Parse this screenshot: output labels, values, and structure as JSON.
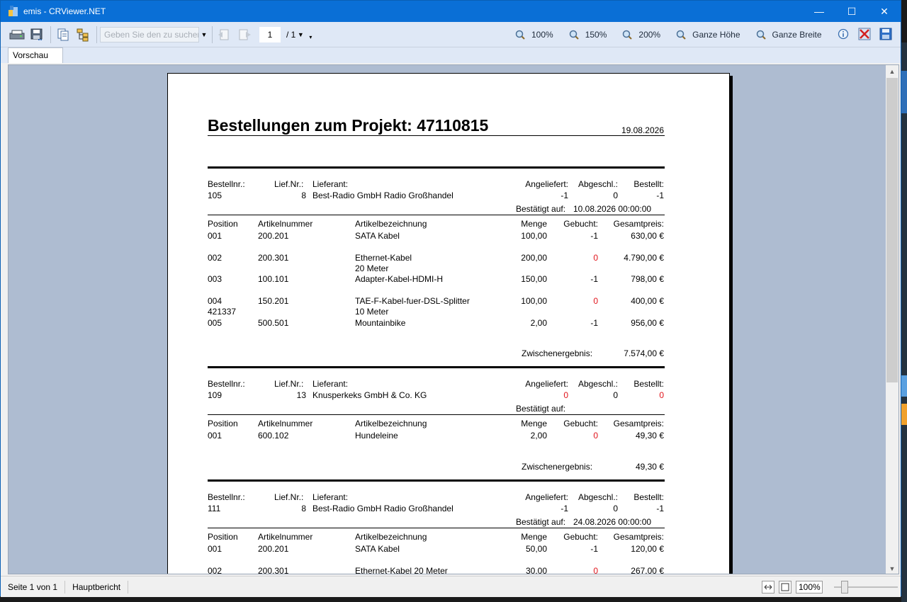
{
  "window": {
    "title": "emis - CRViewer.NET",
    "controls": [
      "—",
      "☐",
      "✕"
    ]
  },
  "toolbar": {
    "search_placeholder": "Geben Sie den zu suchen",
    "page_current": "1",
    "page_total": "/ 1",
    "zoom_buttons": [
      "100%",
      "150%",
      "200%",
      "Ganze Höhe",
      "Ganze Breite"
    ]
  },
  "tabs": [
    "Vorschau"
  ],
  "statusbar": {
    "page": "Seite 1 von 1",
    "report": "Hauptbericht",
    "zoom": "100%"
  },
  "report": {
    "title": "Bestellungen zum Projekt:  47110815",
    "date": "19.08.2026",
    "hdr": {
      "bestellnr": "Bestellnr.:",
      "liefnr": "Lief.Nr.:",
      "lieferant": "Lieferant:",
      "angeliefert": "Angeliefert:",
      "abgeschl": "Abgeschl.:",
      "bestellt": "Bestellt:",
      "bestaetigt": "Bestätigt auf:"
    },
    "col": {
      "position": "Position",
      "artikelnummer": "Artikelnummer",
      "artikelbezeichnung": "Artikelbezeichnung",
      "menge": "Menge",
      "gebucht": "Gebucht:",
      "gesamtpreis": "Gesamtpreis:"
    },
    "zwischen_label": "Zwischenergebnis:",
    "orders": [
      {
        "bestellnr": "105",
        "liefnr": "8",
        "lieferant": "Best-Radio GmbH Radio Großhandel",
        "angeliefert": "-1",
        "abgeschl": "0",
        "bestellt": "-1",
        "bestaetigt": "10.08.2026  00:00:00",
        "items": [
          {
            "pos": "001",
            "artnr": "200.201",
            "bez": "SATA Kabel",
            "bez2": "",
            "pos2": "",
            "menge": "100,00",
            "gebucht": "-1",
            "preis": "630,00 €"
          },
          {
            "pos": "002",
            "artnr": "200.301",
            "bez": "Ethernet-Kabel",
            "bez2": "20 Meter",
            "pos2": "",
            "menge": "200,00",
            "gebucht": "0",
            "preis": "4.790,00 €"
          },
          {
            "pos": "003",
            "artnr": "100.101",
            "bez": "Adapter-Kabel-HDMI-H",
            "bez2": "",
            "pos2": "",
            "menge": "150,00",
            "gebucht": "-1",
            "preis": "798,00 €"
          },
          {
            "pos": "004",
            "artnr": "150.201",
            "bez": "TAE-F-Kabel-fuer-DSL-Splitter",
            "bez2": "10 Meter",
            "pos2": "421337",
            "menge": "100,00",
            "gebucht": "0",
            "preis": "400,00 €"
          },
          {
            "pos": "005",
            "artnr": "500.501",
            "bez": "Mountainbike",
            "bez2": "",
            "pos2": "",
            "menge": "2,00",
            "gebucht": "-1",
            "preis": "956,00 €"
          }
        ],
        "zwischen": "7.574,00 €"
      },
      {
        "bestellnr": "109",
        "liefnr": "13",
        "lieferant": "Knusperkeks GmbH & Co. KG",
        "angeliefert": "0",
        "abgeschl": "0",
        "bestellt": "0",
        "bestaetigt": "",
        "items": [
          {
            "pos": "001",
            "artnr": "600.102",
            "bez": "Hundeleine",
            "bez2": "",
            "pos2": "",
            "menge": "2,00",
            "gebucht": "0",
            "preis": "49,30 €"
          }
        ],
        "zwischen": "49,30 €"
      },
      {
        "bestellnr": "111",
        "liefnr": "8",
        "lieferant": "Best-Radio GmbH Radio Großhandel",
        "angeliefert": "-1",
        "abgeschl": "0",
        "bestellt": "-1",
        "bestaetigt": "24.08.2026  00:00:00",
        "items": [
          {
            "pos": "001",
            "artnr": "200.201",
            "bez": "SATA Kabel",
            "bez2": "",
            "pos2": "",
            "menge": "50,00",
            "gebucht": "-1",
            "preis": "120,00 €"
          },
          {
            "pos": "002",
            "artnr": "200.301",
            "bez": "Ethernet-Kabel 20 Meter",
            "bez2": "",
            "pos2": "",
            "menge": "30,00",
            "gebucht": "0",
            "preis": "267,00 €"
          }
        ],
        "zwischen": ""
      }
    ]
  }
}
